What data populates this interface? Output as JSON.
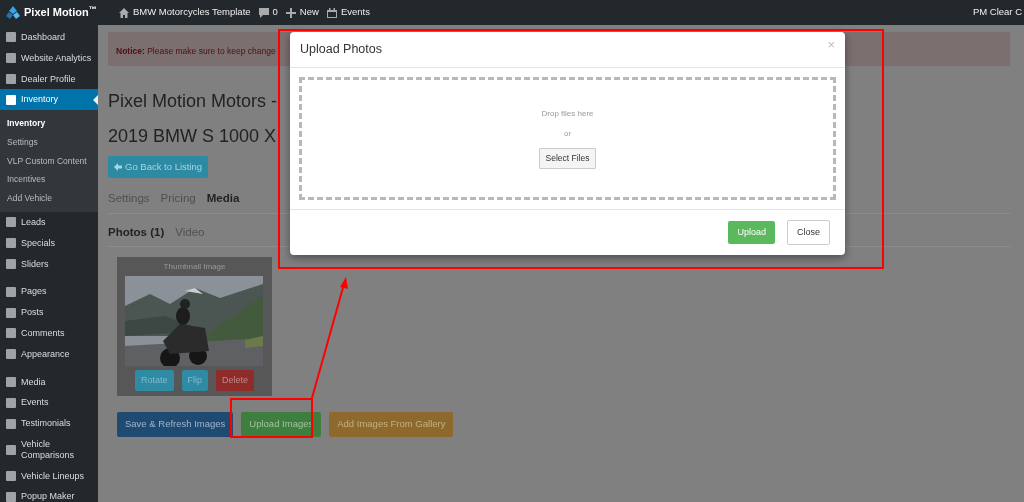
{
  "top_bar": {
    "logo": "Pixel Motion$^{™}$",
    "site": "BMW Motorcycles Template",
    "comments": "0",
    "new": "New",
    "events": "Events",
    "user": "PM Clear C"
  },
  "sidebar": {
    "groups": [
      [
        {
          "label": "Dashboard",
          "selected": false
        },
        {
          "label": "Website Analytics",
          "selected": false
        },
        {
          "label": "Dealer Profile",
          "selected": false
        },
        {
          "label": "Inventory",
          "selected": true,
          "children": [
            {
              "label": "Inventory",
              "selected": true
            },
            {
              "label": "Settings",
              "selected": false
            },
            {
              "label": "VLP Custom Content",
              "selected": false
            },
            {
              "label": "Incentives",
              "selected": false
            },
            {
              "label": "Add Vehicle",
              "selected": false
            }
          ]
        },
        {
          "label": "Leads",
          "selected": false
        },
        {
          "label": "Specials",
          "selected": false
        },
        {
          "label": "Sliders",
          "selected": false
        }
      ],
      [
        {
          "label": "Pages",
          "selected": false
        },
        {
          "label": "Posts",
          "selected": false
        },
        {
          "label": "Comments",
          "selected": false
        },
        {
          "label": "Appearance",
          "selected": false
        }
      ],
      [
        {
          "label": "Media",
          "selected": false
        },
        {
          "label": "Events",
          "selected": false
        },
        {
          "label": "Testimonials",
          "selected": false
        },
        {
          "label": "Vehicle Comparisons",
          "selected": false
        },
        {
          "label": "Vehicle Lineups",
          "selected": false
        },
        {
          "label": "Popup Maker",
          "selected": false
        }
      ]
    ]
  },
  "notice": "**Notice:** Please make sure to keep change",
  "page_title": "Pixel Motion Motors -",
  "vehicle_title": "2019 BMW S 1000 X",
  "back_button": "Go Back to Listing",
  "tabs": [
    {
      "label": "Settings",
      "selected": false
    },
    {
      "label": "Pricing",
      "selected": false
    },
    {
      "label": "Media",
      "selected": true
    }
  ],
  "subtabs": [
    {
      "label": "Photos (1)",
      "selected": true
    },
    {
      "label": "Video",
      "selected": false
    }
  ],
  "thumbnail": {
    "caption": "Thumbnail Image",
    "buttons": [
      {
        "label": "Rotate",
        "kind": "info"
      },
      {
        "label": "Flip",
        "kind": "info"
      },
      {
        "label": "Delete",
        "kind": "danger"
      }
    ]
  },
  "actions": [
    {
      "label": "Save & Refresh Images",
      "kind": "primary"
    },
    {
      "label": "Upload Images",
      "kind": "success"
    },
    {
      "label": "Add Images From Gallery",
      "kind": "warning"
    }
  ],
  "modal": {
    "title": "Upload Photos",
    "close": "×",
    "drop_text": "Drop files here",
    "or": "or",
    "select_button": "Select Files",
    "buttons": [
      {
        "label": "Upload",
        "kind": "success"
      },
      {
        "label": "Close",
        "kind": "default"
      }
    ]
  }
}
